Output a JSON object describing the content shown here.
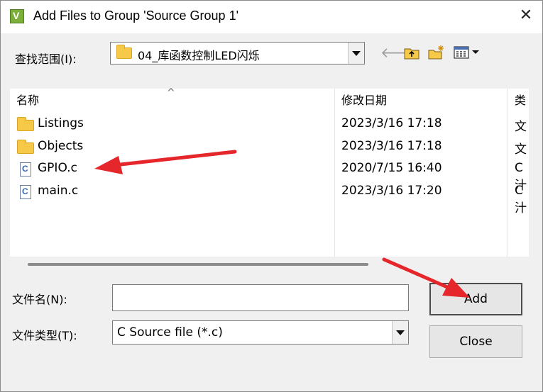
{
  "window": {
    "title": "Add Files to Group 'Source Group 1'",
    "close_glyph": "✕",
    "app_icon": "uvision-app-icon"
  },
  "lookin": {
    "label": "查找范围(I):",
    "value": "04_库函数控制LED闪烁"
  },
  "toolbar": {
    "back_glyph": "🡐",
    "up_glyph": "📂",
    "new_glyph": "📁",
    "view_glyph": "▦▾",
    "icons": [
      "back-arrow-icon",
      "up-one-level-icon",
      "new-folder-icon",
      "view-menu-icon"
    ]
  },
  "list": {
    "columns": [
      "名称",
      "修改日期",
      "类型"
    ],
    "column_header_visible": [
      "名称",
      "修改日期",
      "类"
    ],
    "sort_glyph": "^",
    "rows": [
      {
        "name": "Listings",
        "date": "2023/3/16 17:18",
        "type": "文",
        "icon": "folder-icon"
      },
      {
        "name": "Objects",
        "date": "2023/3/16 17:18",
        "type": "文",
        "icon": "folder-icon"
      },
      {
        "name": "GPIO.c",
        "date": "2020/7/15 16:40",
        "type": "C 汁",
        "icon": "c-file-icon"
      },
      {
        "name": "main.c",
        "date": "2023/3/16 17:20",
        "type": "C 汁",
        "icon": "c-file-icon"
      }
    ]
  },
  "filename": {
    "label": "文件名(N):",
    "value": ""
  },
  "filetype": {
    "label": "文件类型(T):",
    "value": "C Source file (*.c)"
  },
  "buttons": {
    "add": "Add",
    "close": "Close"
  },
  "colors": {
    "arrow_red": "#e5262b",
    "folder_yellow": "#f7c948",
    "dialog_bg": "#f0f0f0"
  }
}
